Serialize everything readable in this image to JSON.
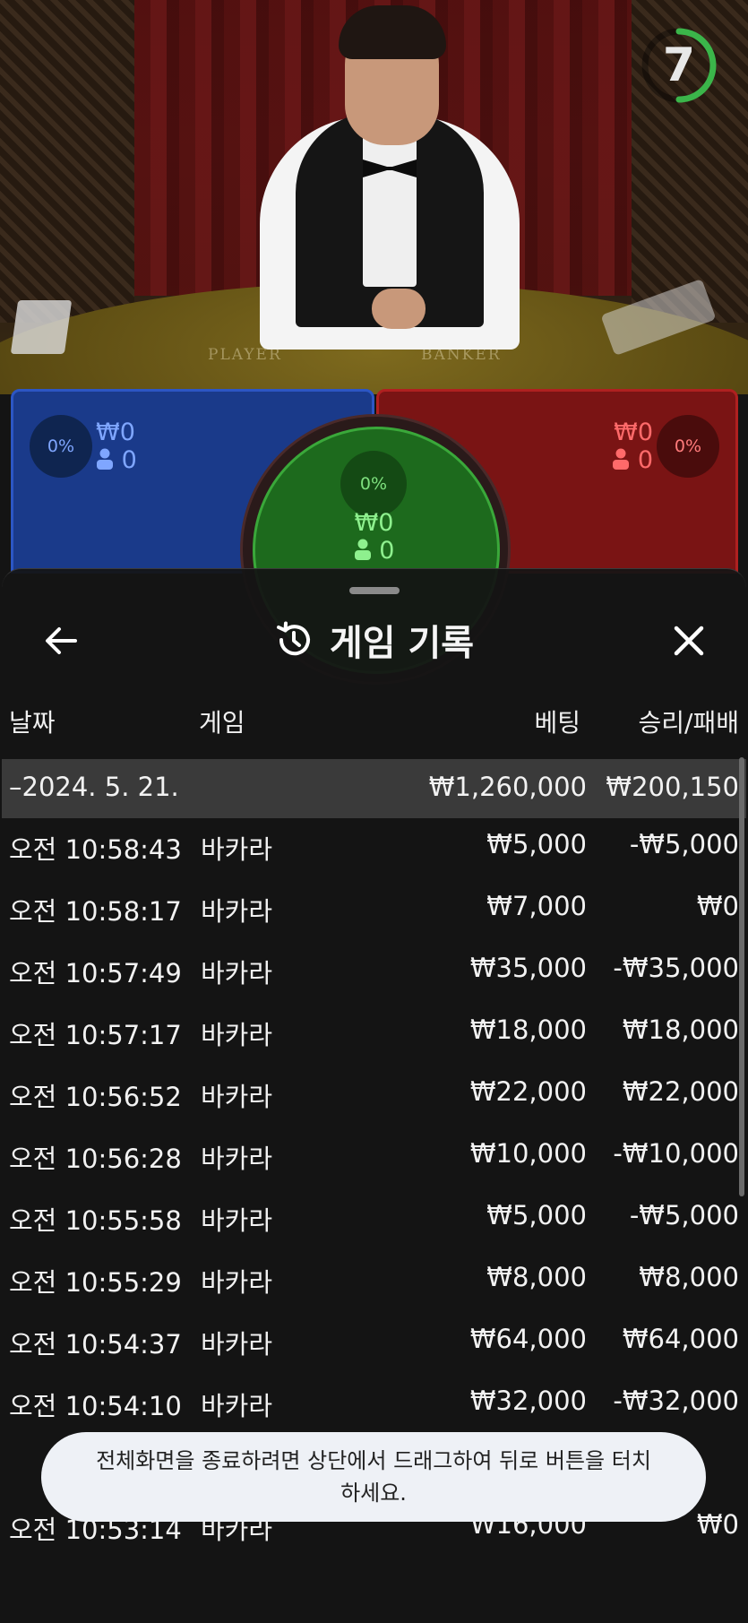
{
  "video": {
    "timer": "7",
    "felt_left": "PLAYER",
    "felt_right": "BANKER"
  },
  "betting": {
    "player": {
      "percent": "0%",
      "amount": "₩0",
      "players": "0"
    },
    "tie": {
      "percent": "0%",
      "amount": "₩0",
      "players": "0"
    },
    "banker": {
      "percent": "0%",
      "amount": "₩0",
      "players": "0"
    }
  },
  "history": {
    "title": "게임 기록",
    "columns": {
      "date": "날짜",
      "game": "게임",
      "bet": "베팅",
      "result": "승리/패배"
    },
    "summary": {
      "date": "–2024. 5. 21.",
      "bet": "₩1,260,000",
      "result": "₩200,150"
    },
    "rows": [
      {
        "time": "오전 10:58:43",
        "game": "바카라",
        "bet": "₩5,000",
        "result": "-₩5,000"
      },
      {
        "time": "오전 10:58:17",
        "game": "바카라",
        "bet": "₩7,000",
        "result": "₩0"
      },
      {
        "time": "오전 10:57:49",
        "game": "바카라",
        "bet": "₩35,000",
        "result": "-₩35,000"
      },
      {
        "time": "오전 10:57:17",
        "game": "바카라",
        "bet": "₩18,000",
        "result": "₩18,000"
      },
      {
        "time": "오전 10:56:52",
        "game": "바카라",
        "bet": "₩22,000",
        "result": "₩22,000"
      },
      {
        "time": "오전 10:56:28",
        "game": "바카라",
        "bet": "₩10,000",
        "result": "-₩10,000"
      },
      {
        "time": "오전 10:55:58",
        "game": "바카라",
        "bet": "₩5,000",
        "result": "-₩5,000"
      },
      {
        "time": "오전 10:55:29",
        "game": "바카라",
        "bet": "₩8,000",
        "result": "₩8,000"
      },
      {
        "time": "오전 10:54:37",
        "game": "바카라",
        "bet": "₩64,000",
        "result": "₩64,000"
      },
      {
        "time": "오전 10:54:10",
        "game": "바카라",
        "bet": "₩32,000",
        "result": "-₩32,000"
      },
      {
        "time": "오전 10:53:14",
        "game": "바카라",
        "bet": "₩16,000",
        "result": "₩0"
      }
    ]
  },
  "toast": {
    "message": "전체화면을 종료하려면 상단에서 드래그하여 뒤로 버튼을 터치하세요."
  },
  "colors": {
    "player": "#1a3a8a",
    "banker": "#7a1414",
    "tie": "#1d6a1d",
    "timer_ring": "#3bb54a"
  }
}
